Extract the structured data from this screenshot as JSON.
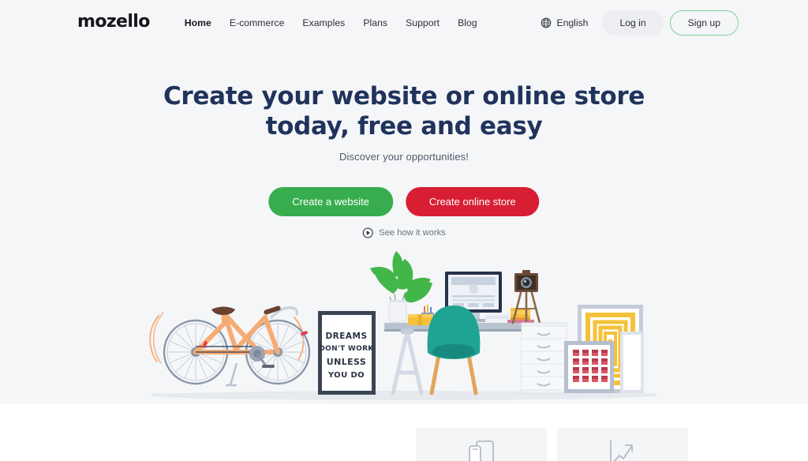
{
  "site": {
    "logo_text": "mozello",
    "background_color": "#f5f6f8"
  },
  "header": {
    "nav": [
      {
        "label": "Home",
        "active": true
      },
      {
        "label": "E-commerce",
        "active": false
      },
      {
        "label": "Examples",
        "active": false
      },
      {
        "label": "Plans",
        "active": false
      },
      {
        "label": "Support",
        "active": false
      },
      {
        "label": "Blog",
        "active": false
      }
    ],
    "language": {
      "label": "English",
      "icon": "globe-icon"
    },
    "login_label": "Log in",
    "signup_label": "Sign up",
    "signup_border_color": "#7fd195"
  },
  "hero": {
    "headline_line1": "Create your website or online store",
    "headline_line2": "today, free and easy",
    "headline_color": "#20335c",
    "subheadline": "Discover your opportunities!",
    "primary_cta": {
      "label": "Create a website",
      "color": "#38ad4f"
    },
    "secondary_cta": {
      "label": "Create online store",
      "color": "#d81e33"
    },
    "video_link": {
      "label": "See how it works",
      "icon": "play-circle-icon"
    }
  },
  "illustration": {
    "poster_text": {
      "line1": "DREAMS",
      "line2": "DON'T WORK",
      "line3": "UNLESS",
      "line4": "YOU DO"
    },
    "objects": [
      "bicycle",
      "motivational-poster",
      "monstera-plant",
      "desk",
      "monitor",
      "pencil-cup",
      "yellow-box",
      "books",
      "vintage-camera-tripod",
      "teal-chair",
      "drawer-cabinet",
      "yellow-abstract-artwork",
      "red-grid-artwork"
    ],
    "bicycle_color": "#f7ab74",
    "chair_color": "#1fa392",
    "plant_color": "#43b649"
  },
  "features": {
    "cards": [
      {
        "icon": "responsive-devices-icon"
      },
      {
        "icon": "growth-chart-icon"
      }
    ]
  }
}
